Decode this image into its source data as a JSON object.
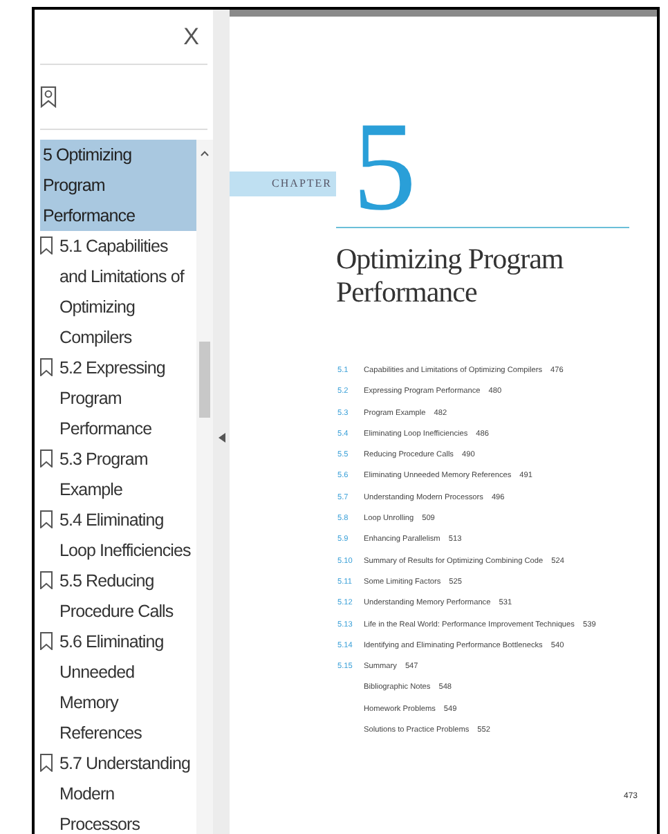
{
  "sidebar": {
    "close": "X",
    "outline": [
      {
        "label": "5 Optimizing Program Performance",
        "selected": true,
        "children": [
          {
            "label": "5.1 Capabilities and Limitations of Optimizing Compilers",
            "selected": false
          },
          {
            "label": "5.2 Expressing Program Performance",
            "selected": false
          },
          {
            "label": "5.3 Program Example",
            "selected": false
          },
          {
            "label": "5.4 Eliminating Loop Inefficiencies",
            "selected": false
          },
          {
            "label": "5.5 Reducing Procedure Calls",
            "selected": false
          },
          {
            "label": "5.6 Eliminating Unneeded Memory References",
            "selected": false
          },
          {
            "label": "5.7 Understanding Modern Processors",
            "selected": false
          }
        ]
      }
    ]
  },
  "page": {
    "chapter_label": "CHAPTER",
    "chapter_number": "5",
    "title": "Optimizing Program Performance",
    "toc": [
      {
        "number": "5.1",
        "title": "Capabilities and Limitations of Optimizing Compilers",
        "page": "476"
      },
      {
        "number": "5.2",
        "title": "Expressing Program Performance",
        "page": "480"
      },
      {
        "number": "5.3",
        "title": "Program Example",
        "page": "482"
      },
      {
        "number": "5.4",
        "title": "Eliminating Loop Inefficiencies",
        "page": "486"
      },
      {
        "number": "5.5",
        "title": "Reducing Procedure Calls",
        "page": "490"
      },
      {
        "number": "5.6",
        "title": "Eliminating Unneeded Memory References",
        "page": "491"
      },
      {
        "number": "5.7",
        "title": "Understanding Modern Processors",
        "page": "496"
      },
      {
        "number": "5.8",
        "title": "Loop Unrolling",
        "page": "509"
      },
      {
        "number": "5.9",
        "title": "Enhancing Parallelism",
        "page": "513"
      },
      {
        "number": "5.10",
        "title": "Summary of Results for Optimizing Combining Code",
        "page": "524"
      },
      {
        "number": "5.11",
        "title": "Some Limiting Factors",
        "page": "525"
      },
      {
        "number": "5.12",
        "title": "Understanding Memory Performance",
        "page": "531"
      },
      {
        "number": "5.13",
        "title": "Life in the Real World: Performance Improvement Techniques",
        "page": "539"
      },
      {
        "number": "5.14",
        "title": "Identifying and Eliminating Performance Bottlenecks",
        "page": "540"
      },
      {
        "number": "5.15",
        "title": "Summary",
        "page": "547"
      },
      {
        "title": "Bibliographic Notes",
        "page": "548"
      },
      {
        "title": "Homework Problems",
        "page": "549"
      },
      {
        "title": "Solutions to Practice Problems",
        "page": "552"
      }
    ],
    "page_number": "473"
  }
}
